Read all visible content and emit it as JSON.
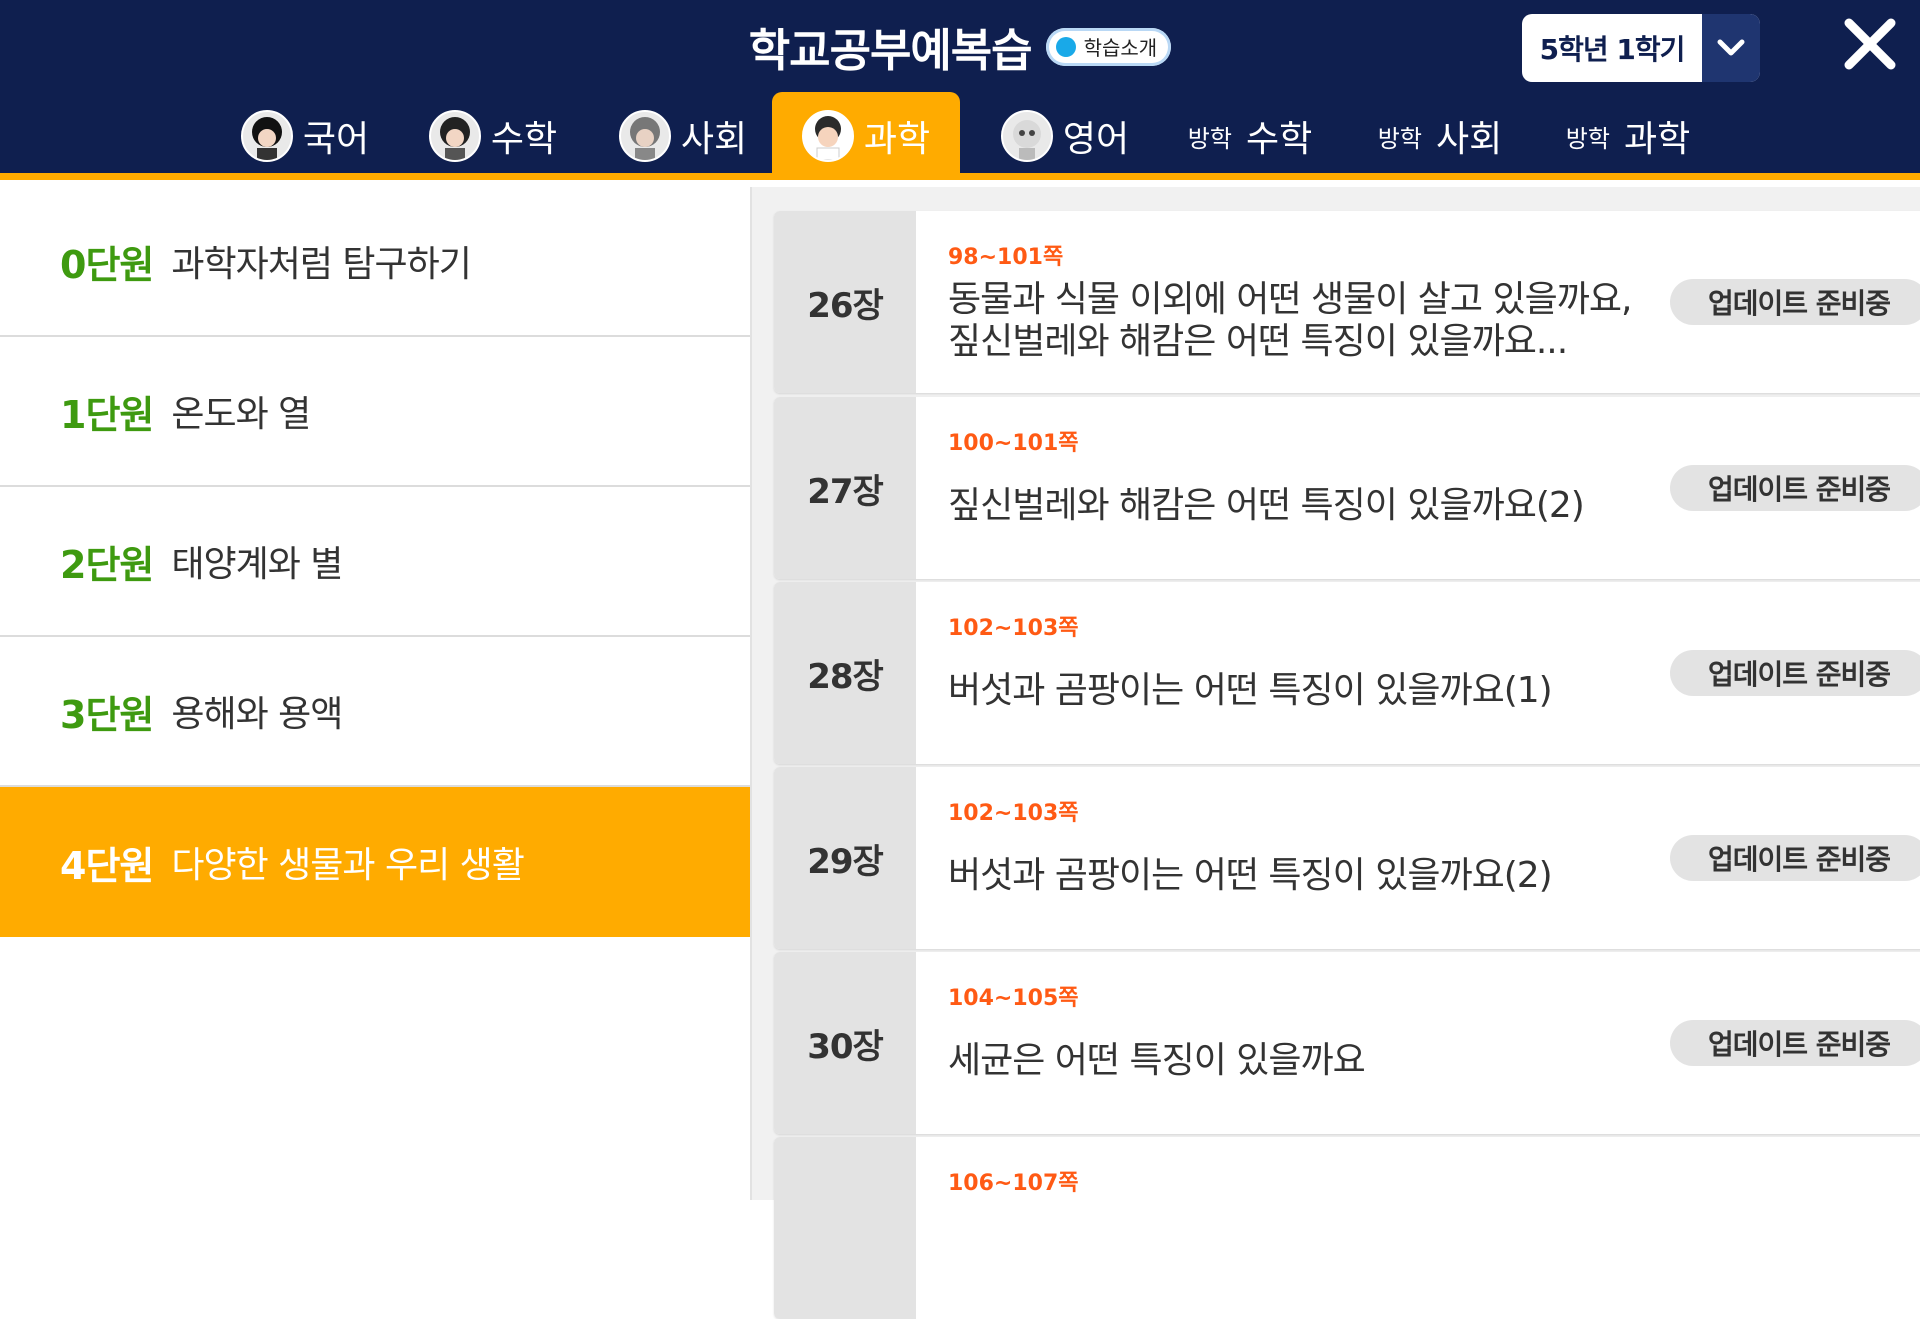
{
  "header": {
    "title": "학교공부예복습",
    "intro_label": "학습소개",
    "grade_select": "5학년 1학기"
  },
  "tabs": [
    {
      "prefix": "",
      "label": "국어",
      "icon": "korean-avatar-icon"
    },
    {
      "prefix": "",
      "label": "수학",
      "icon": "math-avatar-icon"
    },
    {
      "prefix": "",
      "label": "사회",
      "icon": "social-avatar-icon"
    },
    {
      "prefix": "",
      "label": "과학",
      "icon": "science-avatar-icon",
      "active": true
    },
    {
      "prefix": "",
      "label": "영어",
      "icon": "english-robot-icon"
    },
    {
      "prefix": "방학",
      "label": "수학"
    },
    {
      "prefix": "방학",
      "label": "사회"
    },
    {
      "prefix": "방학",
      "label": "과학"
    }
  ],
  "units": [
    {
      "num": "0단원",
      "name": "과학자처럼 탐구하기"
    },
    {
      "num": "1단원",
      "name": "온도와 열"
    },
    {
      "num": "2단원",
      "name": "태양계와 별"
    },
    {
      "num": "3단원",
      "name": "용해와 용액"
    },
    {
      "num": "4단원",
      "name": "다양한 생물과 우리 생활",
      "active": true
    }
  ],
  "lessons": [
    {
      "num": "26장",
      "pages": "98~101쪽",
      "title": "동물과 식물 이외에 어떤 생물이 살고 있을까요, 짚신벌레와 해캄은 어떤 특징이 있을까요...",
      "status": "업데이트 준비중"
    },
    {
      "num": "27장",
      "pages": "100~101쪽",
      "title": "짚신벌레와 해캄은 어떤 특징이 있을까요(2)",
      "status": "업데이트 준비중"
    },
    {
      "num": "28장",
      "pages": "102~103쪽",
      "title": "버섯과 곰팡이는 어떤 특징이 있을까요(1)",
      "status": "업데이트 준비중"
    },
    {
      "num": "29장",
      "pages": "102~103쪽",
      "title": "버섯과 곰팡이는 어떤 특징이 있을까요(2)",
      "status": "업데이트 준비중"
    },
    {
      "num": "30장",
      "pages": "104~105쪽",
      "title": "세균은 어떤 특징이 있을까요",
      "status": "업데이트 준비중"
    },
    {
      "num": "",
      "pages": "106~107쪽",
      "title": "",
      "status": ""
    }
  ],
  "colors": {
    "header_bg": "#0f1f4f",
    "accent": "#ffab00",
    "unit_number": "#3e9a10",
    "pages_text": "#ff5a14"
  }
}
